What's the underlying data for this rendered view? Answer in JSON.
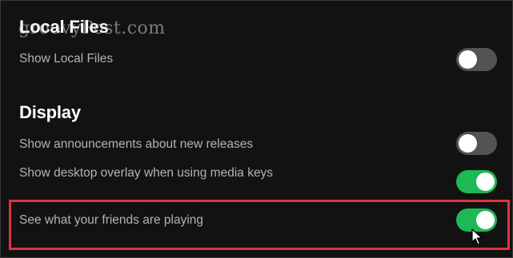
{
  "sections": {
    "local_files": {
      "title": "Local Files",
      "items": [
        {
          "label": "Show Local Files",
          "enabled": false
        }
      ]
    },
    "display": {
      "title": "Display",
      "items": [
        {
          "label": "Show announcements about new releases",
          "enabled": false
        },
        {
          "label": "Show desktop overlay when using media keys",
          "enabled": true
        },
        {
          "label": "See what your friends are playing",
          "enabled": true
        }
      ]
    }
  },
  "watermark": "groovyPost.com",
  "colors": {
    "background": "#121212",
    "toggle_on": "#1db954",
    "toggle_off": "#535353",
    "highlight": "#e0343c"
  }
}
